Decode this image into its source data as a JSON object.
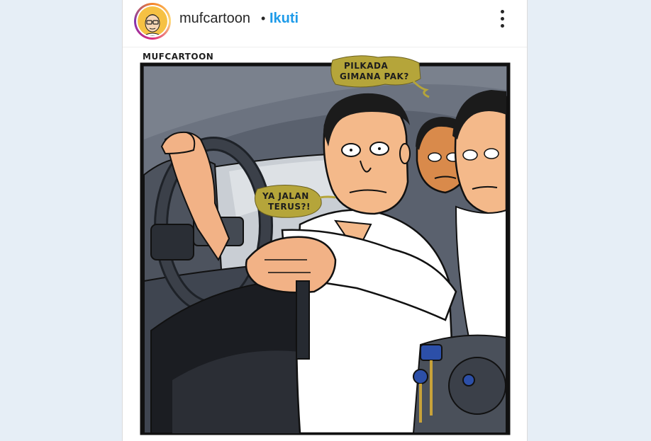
{
  "post": {
    "username": "mufcartoon",
    "separator": "•",
    "follow_label": "Ikuti",
    "more_icon": "more-vertical-icon"
  },
  "comic": {
    "credit": "MUFCARTOON",
    "bubble_top": [
      "PILKADA",
      "GIMANA PAK?"
    ],
    "bubble_left": [
      "YA JALAN",
      "TERUS?!"
    ]
  },
  "colors": {
    "follow_blue": "#1e9be9",
    "speech_bubble": "#b5a53a",
    "car_interior": "#5b626f",
    "shirt": "#ffffff",
    "skin": "#f4b98a"
  }
}
